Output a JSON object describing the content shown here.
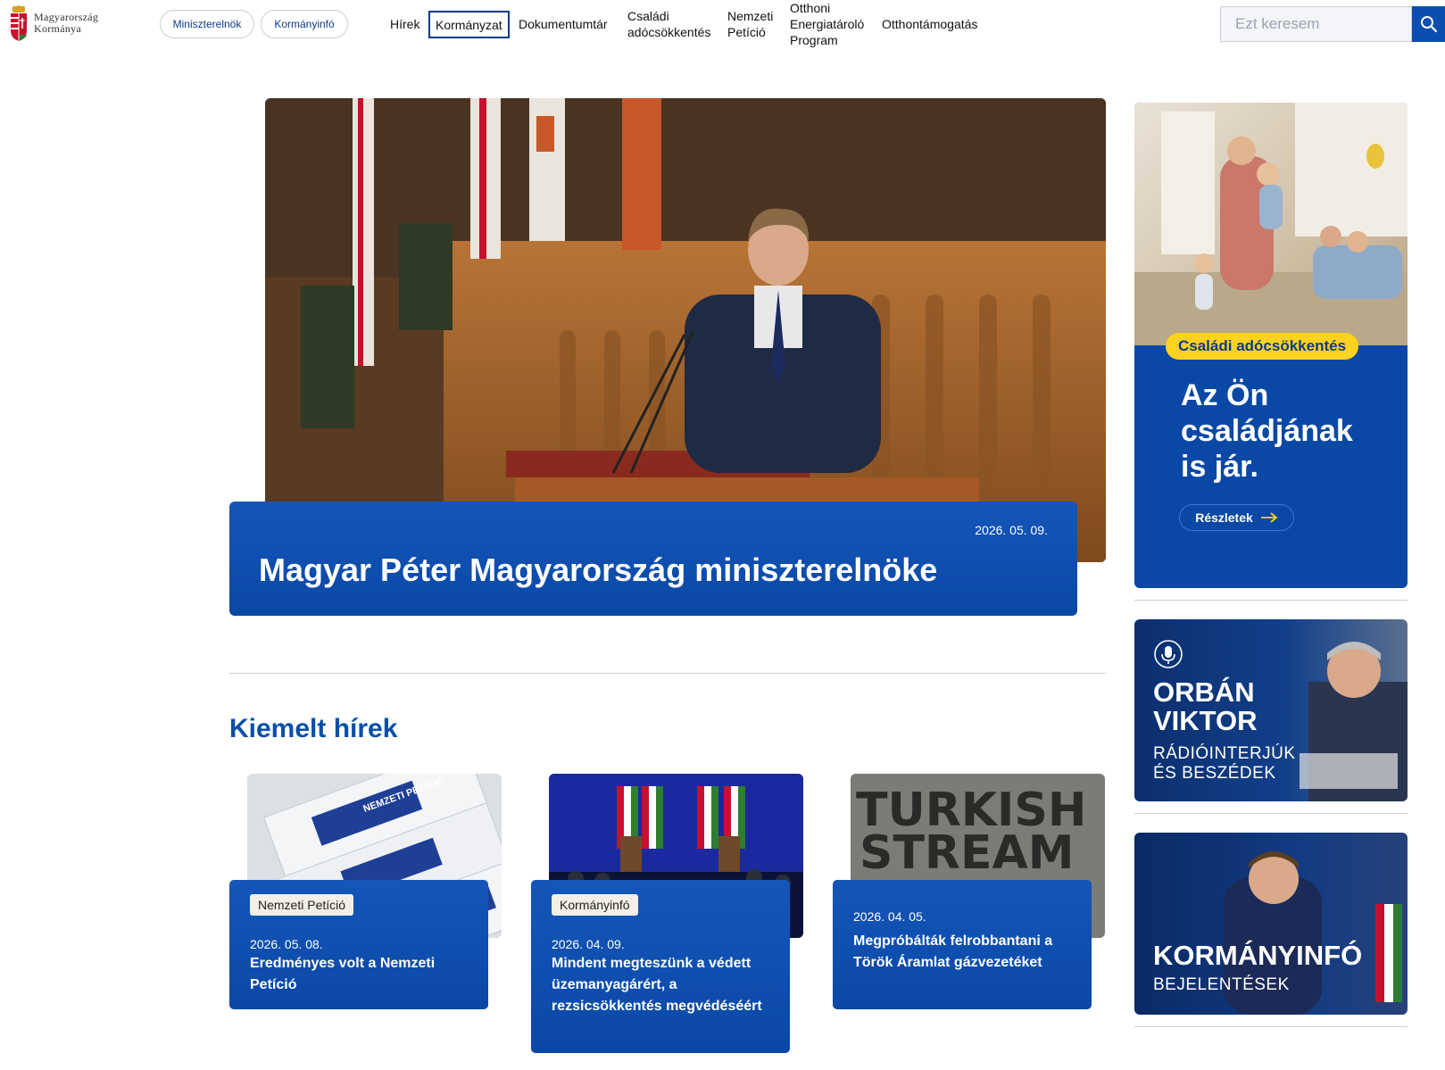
{
  "header": {
    "logo_line1": "Magyarország",
    "logo_line2": "Kormánya",
    "pills": [
      "Miniszterelnök",
      "Kormányinfó"
    ],
    "nav": {
      "hirek": "Hírek",
      "kormanyzat": "Kormányzat",
      "dokumentumtar": "Dokumentumtár",
      "csaladi_line1": "Családi",
      "csaladi_line2": "adócsökkentés",
      "nemzeti_line1": "Nemzeti",
      "nemzeti_line2": "Petíció",
      "otthoni_line1": "Otthoni",
      "otthoni_line2": "Energiatároló",
      "otthoni_line3": "Program",
      "otthontamogatas": "Otthontámogatás"
    },
    "search_placeholder": "Ezt keresem"
  },
  "hero": {
    "date": "2026. 05. 09.",
    "title": "Magyar Péter Magyarország miniszterelnöke"
  },
  "featured": {
    "section_title": "Kiemelt hírek",
    "items": [
      {
        "tag": "Nemzeti Petíció",
        "date": "2026. 05. 08.",
        "title": "Eredményes volt a Nemzeti Petíció"
      },
      {
        "tag": "Kormányinfó",
        "date": "2026. 04. 09.",
        "title": "Mindent megteszünk a védett üzemanyagárért, a rezsicsökkentés megvédéséért"
      },
      {
        "tag": "",
        "date": "2026. 04. 05.",
        "title": "Megpróbálták felrobbantani a Török Áramlat gázvezetéket"
      }
    ],
    "image_texts": [
      "NEMZETI PETÍCIÓ",
      "TURKISH",
      "STREAM"
    ]
  },
  "sidebar": {
    "promo": {
      "badge": "Családi adócsökkentés",
      "heading": "Az Ön családjának is jár.",
      "button": "Részletek"
    },
    "box1": {
      "line1": "ORBÁN",
      "line2": "VIKTOR",
      "line3": "RÁDIÓINTERJÚK",
      "line4": "ÉS BESZÉDEK"
    },
    "box2": {
      "line1": "KORMÁNYINFÓ",
      "line2": "BEJELENTÉSEK"
    }
  },
  "colors": {
    "brand_blue": "#0a48a6",
    "accent_yellow": "#ffd21f",
    "title_blue": "#0a4fa8"
  }
}
